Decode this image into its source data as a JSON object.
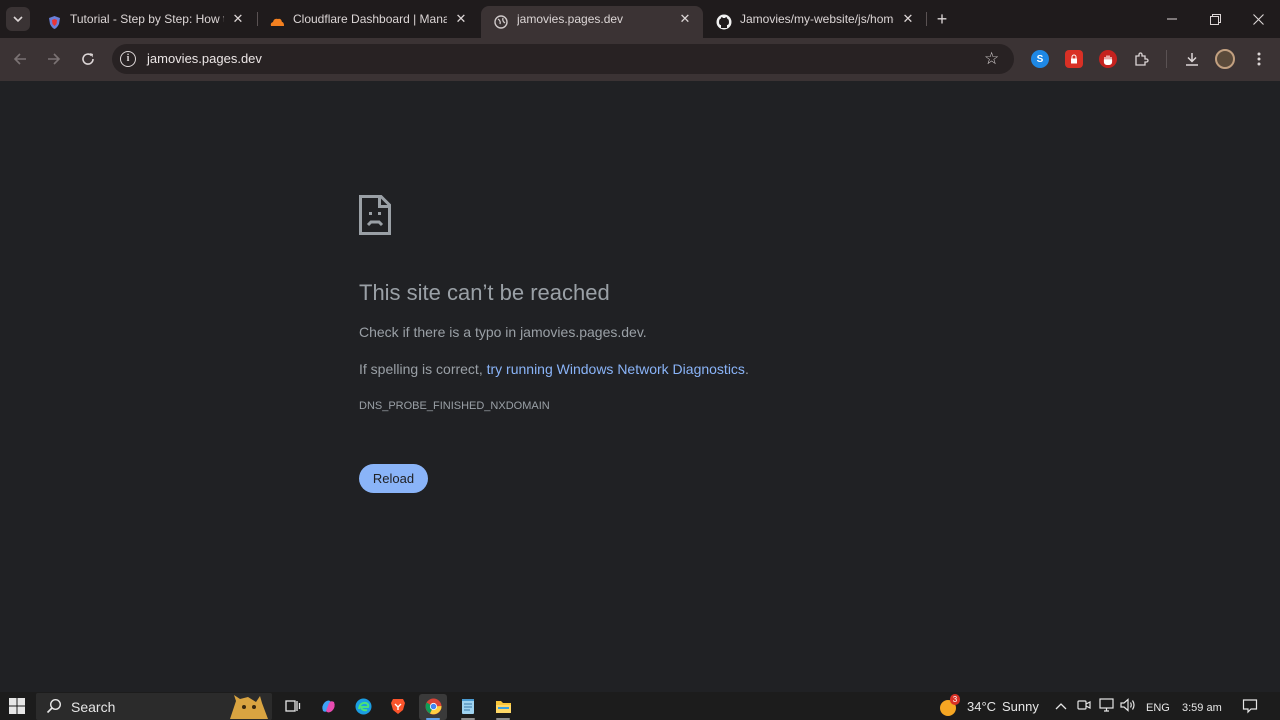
{
  "browser": {
    "tabs": [
      {
        "title": "Tutorial - Step by Step: How to",
        "favicon": "shield-logo-icon",
        "active": false
      },
      {
        "title": "Cloudflare Dashboard | Manage",
        "favicon": "cloudflare-icon",
        "active": false
      },
      {
        "title": "jamovies.pages.dev",
        "favicon": "globe-icon",
        "active": true
      },
      {
        "title": "Jamovies/my-website/js/home.j",
        "favicon": "github-icon",
        "active": false
      }
    ],
    "new_tab_label": "+",
    "window_controls": {
      "minimize": "—",
      "restore": "❐",
      "close": "✕"
    },
    "address_bar": {
      "url": "jamovies.pages.dev"
    }
  },
  "error_page": {
    "title": "This site can’t be reached",
    "line1": "Check if there is a typo in jamovies.pages.dev.",
    "line2_prefix": "If spelling is correct, ",
    "line2_link": "try running Windows Network Diagnostics",
    "line2_suffix": ".",
    "error_code": "DNS_PROBE_FINISHED_NXDOMAIN",
    "reload_label": "Reload"
  },
  "taskbar": {
    "search_label": "Search",
    "weather_temp": "34°C",
    "weather_desc": "Sunny",
    "weather_badge": "3",
    "language": "ENG",
    "time": "3:59 am"
  },
  "colors": {
    "page_bg": "#202124",
    "link": "#8ab4f8",
    "reload_button": "#8ab4f8",
    "text_secondary": "#9aa0a6",
    "tabstrip_bg": "#1f1b1c",
    "toolbar_bg": "#3b3334"
  }
}
